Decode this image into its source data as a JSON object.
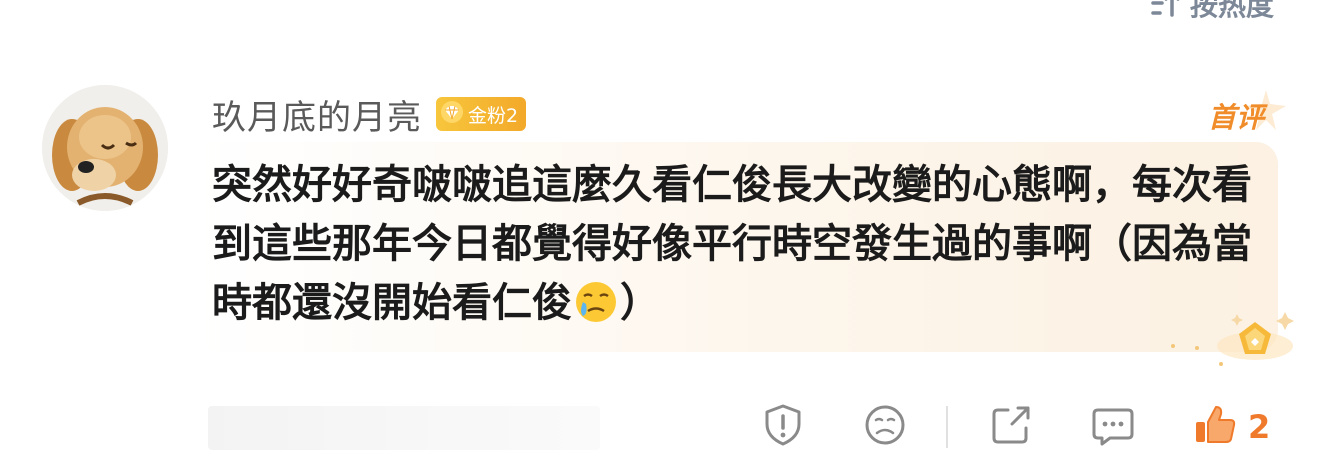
{
  "sort": {
    "label": "按热度",
    "icon": "sort-icon"
  },
  "comment": {
    "username": "玖月底的月亮",
    "fan_badge": {
      "label": "金粉2",
      "icon": "diamond-icon",
      "color": "#f5b731"
    },
    "first_comment_label": "首评",
    "text_part1": "突然好好奇啵啵追這麼久看仁俊長大改變的心態啊，每次看到這些那年今日都覺得好像平行時空發生過的事啊（因為當時都還沒開始看仁俊",
    "emoji": "crying-face-emoji",
    "text_part2": "）"
  },
  "actions": {
    "report": {
      "icon": "report-icon"
    },
    "dislike": {
      "icon": "dislike-face-icon"
    },
    "share": {
      "icon": "share-icon"
    },
    "reply": {
      "icon": "reply-icon"
    },
    "like": {
      "icon": "thumbs-up-icon",
      "count": "2",
      "color": "#f07a2b"
    }
  },
  "colors": {
    "accent": "#f08c29",
    "muted": "#7c8797",
    "text": "#1b1b1b"
  }
}
